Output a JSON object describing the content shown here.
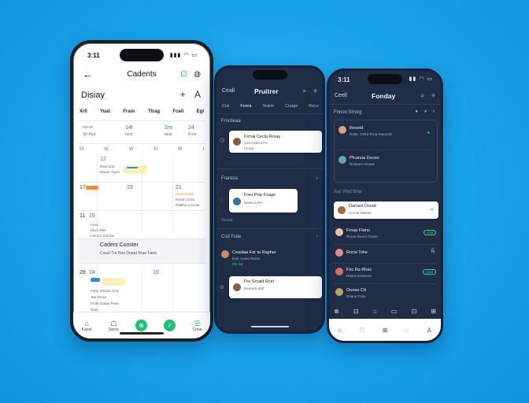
{
  "phone1": {
    "status_time": "3:11",
    "status_icons": "▮▮▮ ◠ ▭",
    "back": "←",
    "title": "Cadents",
    "header_icons": [
      "⊡",
      "◍"
    ],
    "subtitle": "Disiay",
    "sub_icons": [
      "+",
      "A"
    ],
    "days": [
      "Xr0",
      "Yuat",
      "Frsor",
      "Ttrag",
      "Fcell",
      "Egl"
    ],
    "summary_left": [
      "ea+re",
      "Str Aaa"
    ],
    "summary_center": [
      "14t",
      "tantr"
    ],
    "summary_right": [
      "2re",
      "taiar"
    ],
    "summary_far": [
      "24",
      "Enar"
    ],
    "week_labels": [
      "M",
      "W",
      "W",
      "N",
      "M",
      "I"
    ],
    "cells": {
      "c1": "12",
      "c1_lines": [
        "Rsal Srac",
        "Racan Gyoe"
      ],
      "c2": "17",
      "c3": "23",
      "c3_lines": [
        "Nrrarh Coso",
        "Ratkha Lnocan"
      ],
      "c4": "11",
      "c5": "21",
      "c5_line": "Arrar Sroes",
      "r1": "19",
      "r2": "13",
      "r2b": "24",
      "r3": "28",
      "r3_lines": [
        "Aoss",
        "Kbvo Rtet"
      ],
      "r4": "13",
      "r4_lines": [
        "Lterton Sal Sat",
        "Rerlra Dcrct"
      ]
    },
    "banner_title": "Cadent Cooster",
    "banner_sub": "Cosal Tra Rea Dratat Rrae Faetr",
    "lower": {
      "num_a": "24",
      "num_b": "23",
      "num_c": "19",
      "lines": [
        "Fahn Srtdvar Soa",
        "Tan Ghovr",
        "Frrda Gtaaa Peae",
        "Rars",
        "Trasd Rrees Dtran"
      ]
    },
    "tabs": [
      {
        "icon": "⌂",
        "label": "Kanal"
      },
      {
        "icon": "☖",
        "label": "Sacra"
      },
      {
        "icon": "⊕",
        "label": ""
      },
      {
        "icon": "✓",
        "label": ""
      },
      {
        "icon": "☰",
        "label": "Cnsa"
      }
    ]
  },
  "phone2": {
    "back": "Ceall",
    "title": "Pruitrer",
    "icons": [
      "⌕",
      "✧"
    ],
    "tabs": [
      "Ciai",
      "Fcrea",
      "Teane",
      "Cnage",
      "Rece"
    ],
    "section1": "Frnclieaa",
    "card1": {
      "title": "Frrnai Cecla Rroay",
      "sub": "Aoo-rca0cd Fa",
      "sub2": "Frrase"
    },
    "section2": "Frardoa",
    "card2": {
      "title": "Fren Prar Fsage",
      "sub": "Neetcra Re"
    },
    "section2b": "Tesaal",
    "section3": "Csd Fiaie",
    "item1": {
      "title": "Coaslaa Far ta Rapher",
      "sub": "Kolt, Antea Raren",
      "sub2": "Ris Sd"
    },
    "card3": {
      "title": "Fre Srcaid Rcer",
      "sub": "Neetara Sart"
    }
  },
  "phone3": {
    "status_time": "3:11",
    "status_icons": "▮▮ ◠ ▭",
    "back": "Ceell",
    "title": "Fonday",
    "icons": [
      "⌕",
      "✧"
    ],
    "section1": "Fnnon Srrorg",
    "section1_badges": [
      "●",
      "●",
      "‹"
    ],
    "item1": {
      "title": "Resetd",
      "sub": "Rotte, Cthrd Rroa Ratnorid",
      "badge": "●"
    },
    "item2": {
      "title": "Pfcanoa Dooso",
      "sub": "Roiteant Vloaoe"
    },
    "section2": "Aut Vhid Brar",
    "card1": {
      "title": "Darrant Dorad",
      "sub": "Crunst Dalerte",
      "chev": "⌄"
    },
    "item3": {
      "title": "Froup Ftano",
      "sub": "Roree-Duorn Thaen",
      "pill": "Ctal"
    },
    "item4": {
      "title": "Rocw Tohe",
      "sub": "",
      "pill": "Ñ"
    },
    "item5": {
      "title": "Foc Ra Rlrac",
      "sub": "Ratna Drebarae",
      "pill": "Ciaa"
    },
    "item6": {
      "title": "Oonae Ctt",
      "sub": "Dnane Fane"
    },
    "quick_icons": [
      "⊗",
      "⊡",
      "⌂",
      "▭",
      "⊡",
      "⊞"
    ],
    "tabs": [
      "⌂",
      "♡",
      "⊞",
      "◌",
      "♙"
    ]
  }
}
